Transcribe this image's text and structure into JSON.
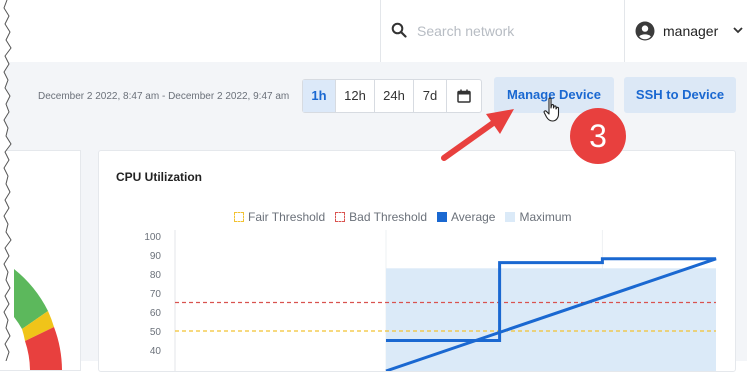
{
  "header": {
    "search": {
      "placeholder": "Search network",
      "icon": "search-icon"
    },
    "user": {
      "name": "manager",
      "icon": "account-circle-icon"
    }
  },
  "toolbar": {
    "date_range": "December 2 2022, 8:47 am - December 2 2022, 9:47 am",
    "ranges": [
      {
        "label": "1h",
        "active": true
      },
      {
        "label": "12h",
        "active": false
      },
      {
        "label": "24h",
        "active": false
      },
      {
        "label": "7d",
        "active": false
      }
    ],
    "calendar_icon": "calendar-icon",
    "manage_device_label": "Manage Device",
    "ssh_label": "SSH to Device"
  },
  "annotation": {
    "step_number": "3",
    "accent_color": "#e8403e"
  },
  "colors": {
    "fair_threshold": "#f2c230",
    "bad_threshold": "#d9534f",
    "average": "#1a68d1",
    "maximum": "#dbeaf8"
  },
  "chart_data": {
    "type": "line",
    "title": "CPU Utilization",
    "legend": [
      "Fair Threshold",
      "Bad Threshold",
      "Average",
      "Maximum"
    ],
    "y_ticks": [
      "100",
      "90",
      "80",
      "70",
      "60",
      "50",
      "40"
    ],
    "ylim": [
      40,
      100
    ],
    "fair_threshold": 50,
    "bad_threshold": 65,
    "average_steps": [
      {
        "x": 0.39,
        "y": 45
      },
      {
        "x": 0.6,
        "y": 45
      },
      {
        "x": 0.6,
        "y": 86
      },
      {
        "x": 0.79,
        "y": 86
      },
      {
        "x": 0.79,
        "y": 88
      },
      {
        "x": 1.0,
        "y": 88
      }
    ],
    "maximum_band": {
      "x_start": 0.39,
      "x_end": 1.0,
      "y": 83
    },
    "legend_position": "top-center",
    "grid": true
  }
}
